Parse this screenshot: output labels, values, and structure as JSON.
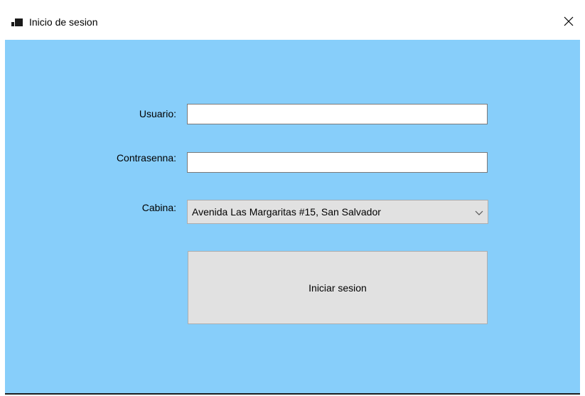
{
  "window": {
    "title": "Inicio de sesion",
    "client_color": "#87cefa"
  },
  "form": {
    "usuario_label": "Usuario:",
    "usuario_value": "",
    "contrasena_label": "Contrasenna:",
    "contrasena_value": "",
    "cabina_label": "Cabina:",
    "cabina_selected": "Avenida Las Margaritas #15, San Salvador",
    "login_button_label": "Iniciar sesion"
  },
  "icons": {
    "app": "app-icon",
    "close": "close-icon",
    "dropdown": "chevron-down-icon"
  }
}
